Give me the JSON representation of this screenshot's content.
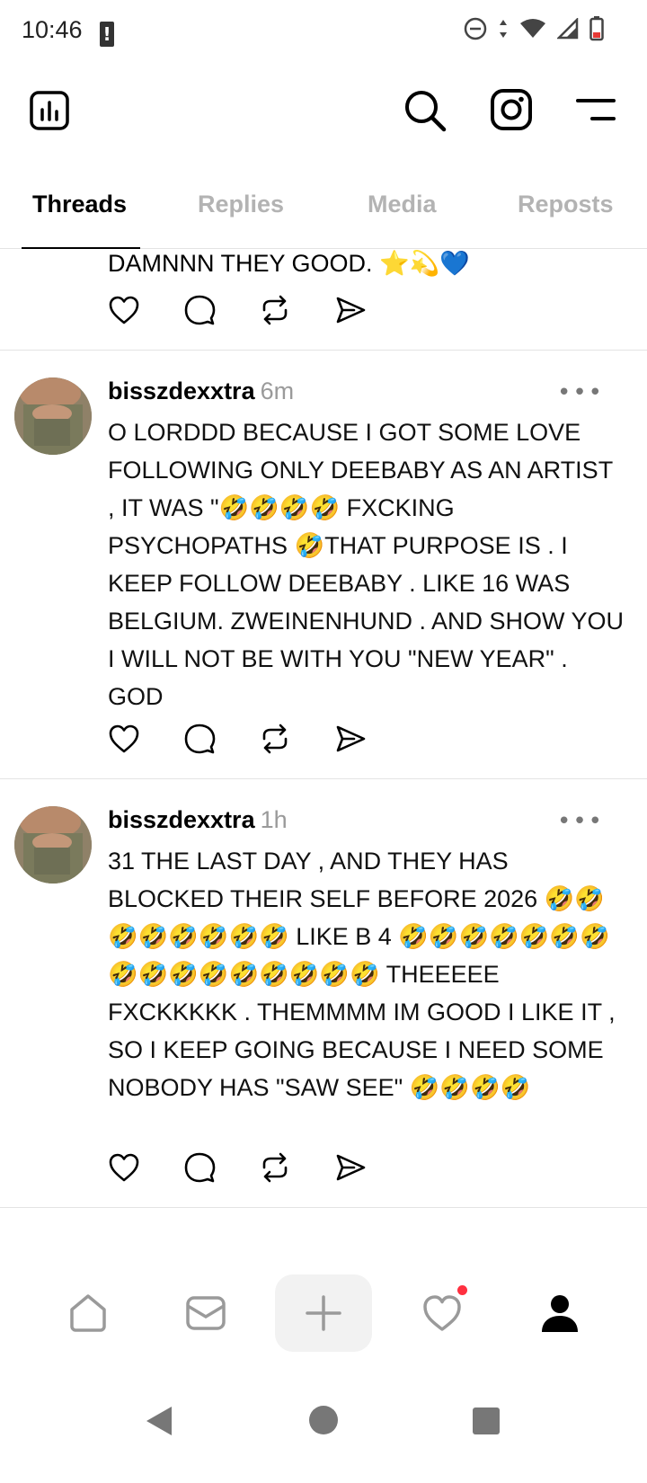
{
  "status_bar": {
    "time": "10:46",
    "icons": [
      "alert-icon",
      "dnd-icon",
      "data-arrows-icon",
      "wifi-icon",
      "signal-icon",
      "battery-low-icon"
    ]
  },
  "top_bar": {
    "icons": [
      "insights-icon",
      "search-icon",
      "instagram-icon",
      "menu-icon"
    ]
  },
  "tabs": [
    {
      "label": "Threads",
      "active": true
    },
    {
      "label": "Replies",
      "active": false
    },
    {
      "label": "Media",
      "active": false
    },
    {
      "label": "Reposts",
      "active": false
    }
  ],
  "feed": {
    "partial_post": {
      "text": "DAMNNN THEY GOOD. ⭐💫💙"
    },
    "posts": [
      {
        "username": "bisszdexxtra",
        "time": "6m",
        "text": "O LORDDD BECAUSE I GOT SOME LOVE FOLLOWING ONLY DEEBABY AS AN ARTIST , IT WAS \"🤣🤣🤣🤣 FXCKING PSYCHOPATHS 🤣THAT PURPOSE IS . I KEEP FOLLOW DEEBABY . LIKE 16 WAS BELGIUM. ZWEINENHUND . AND SHOW YOU I WILL NOT BE WITH YOU \"NEW YEAR\" . GOD"
      },
      {
        "username": "bisszdexxtra",
        "time": "1h",
        "text": "31 THE LAST DAY , AND THEY HAS BLOCKED THEIR SELF BEFORE 2026 🤣🤣🤣🤣🤣🤣🤣🤣 LIKE B 4 🤣🤣🤣🤣🤣🤣🤣🤣🤣🤣🤣🤣🤣🤣🤣🤣 THEEEEE FXCKKKKK . THEMMMM IM GOOD I LIKE IT , SO I KEEP GOING BECAUSE I NEED SOME NOBODY HAS \"SAW SEE\" 🤣🤣🤣🤣"
      }
    ],
    "action_icons": [
      "like-icon",
      "comment-icon",
      "repost-icon",
      "share-icon"
    ],
    "more_label": "•••"
  },
  "bottom_nav": {
    "items": [
      "home-icon",
      "inbox-icon",
      "new-thread-icon",
      "activity-icon",
      "profile-icon"
    ],
    "activity_has_notification": true,
    "notification_color": "#ff3040"
  },
  "system_nav": [
    "back-icon",
    "home-circle-icon",
    "recents-icon"
  ],
  "colors": {
    "muted": "#b3b3b3",
    "divider": "#e3e3e3"
  }
}
